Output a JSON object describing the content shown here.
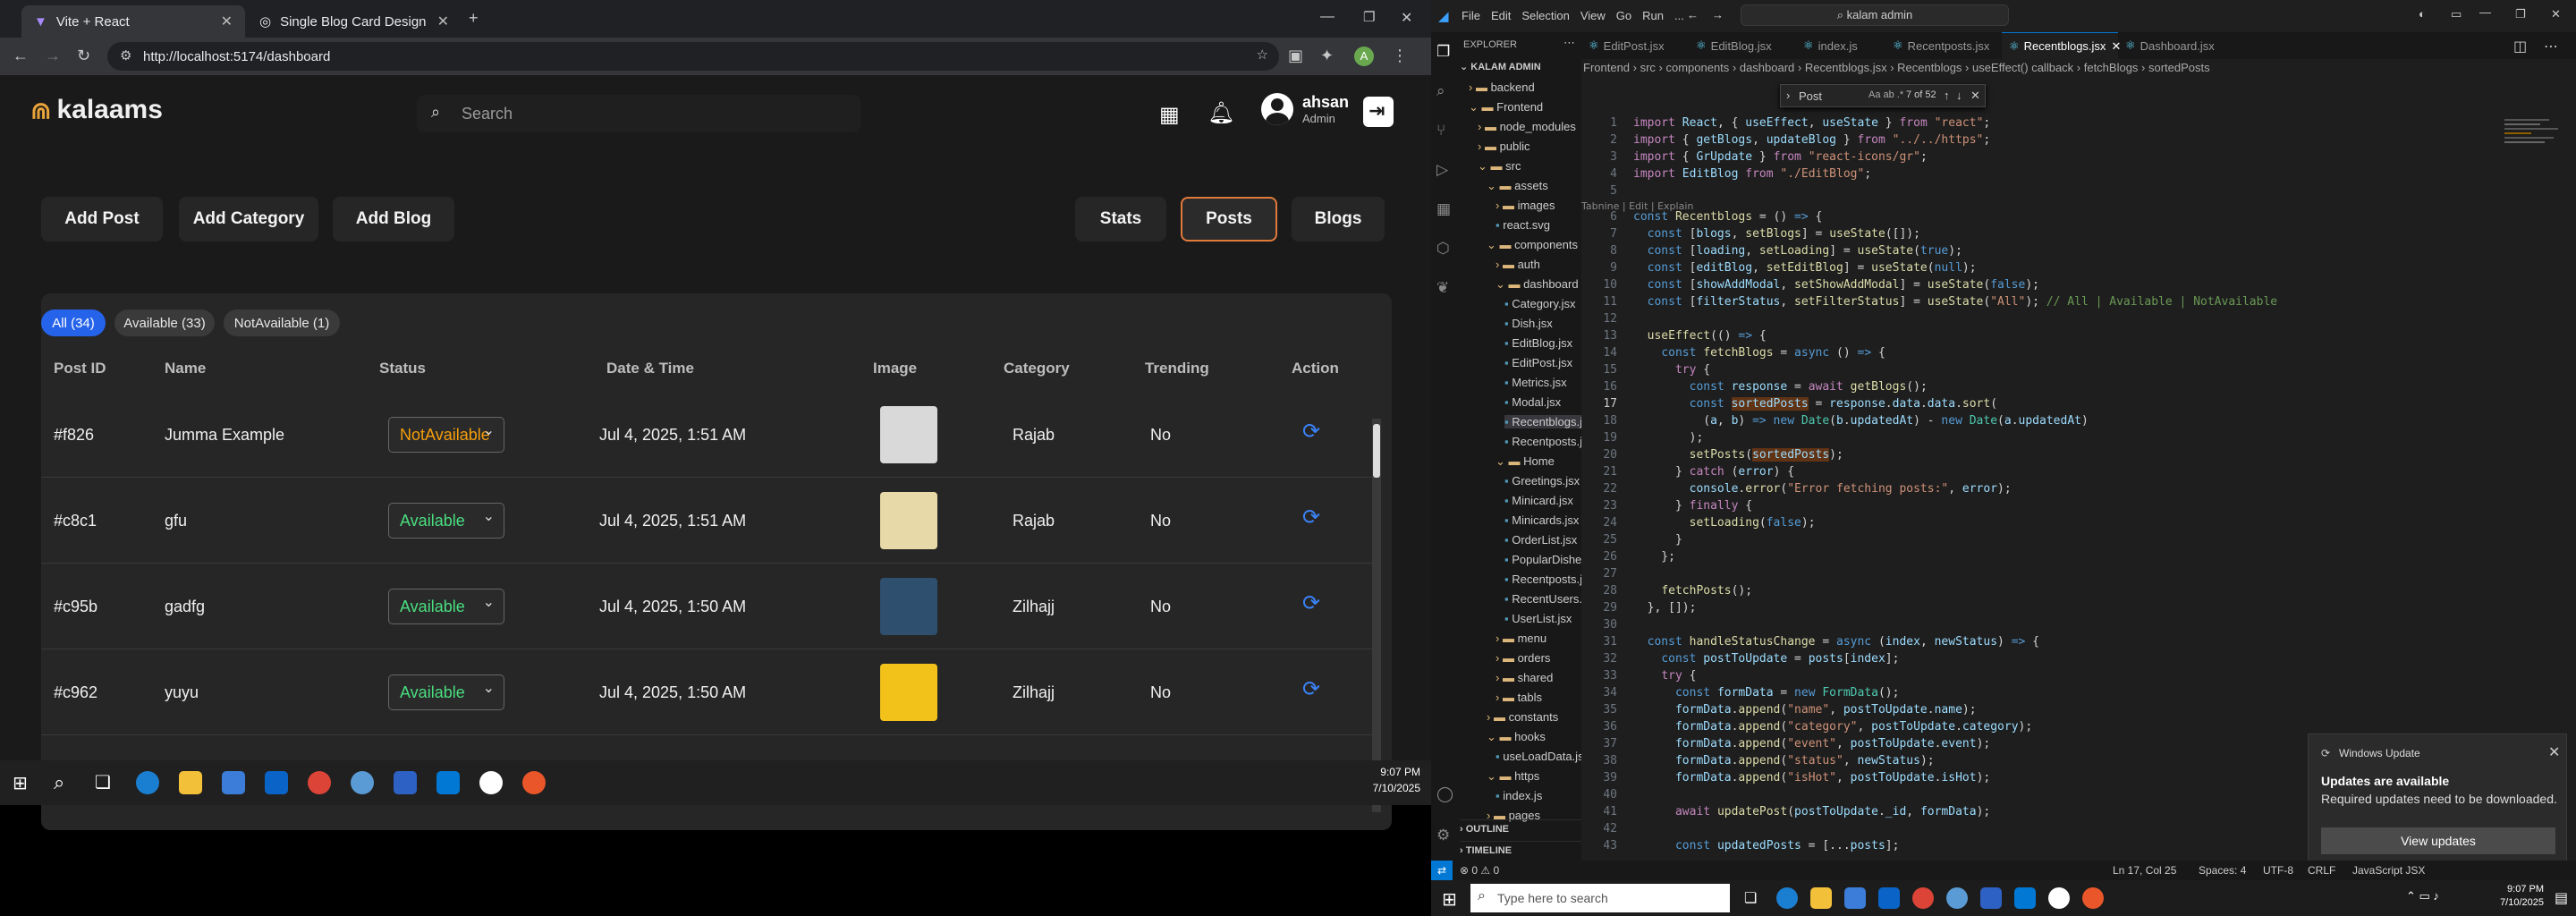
{
  "browser": {
    "tabs": [
      {
        "title": "Vite + React"
      },
      {
        "title": "Single Blog Card Design"
      }
    ],
    "url": "http://localhost:5174/dashboard"
  },
  "app": {
    "logo": "kalaams",
    "search_placeholder": "Search",
    "user": {
      "name": "ahsan",
      "role": "Admin"
    },
    "actions": [
      "Add Post",
      "Add Category",
      "Add Blog"
    ],
    "views": [
      "Stats",
      "Posts",
      "Blogs"
    ],
    "active_view": "Posts",
    "filters": [
      "All (34)",
      "Available (33)",
      "NotAvailable (1)"
    ],
    "columns": [
      "Post ID",
      "Name",
      "Status",
      "Date & Time",
      "Image",
      "Category",
      "Trending",
      "Action"
    ],
    "rows": [
      {
        "id": "#f826",
        "name": "Jumma Example",
        "status": "NotAvailable",
        "date": "Jul 4, 2025, 1:51 AM",
        "category": "Rajab",
        "trending": "No",
        "thumb": "#d9d9d9"
      },
      {
        "id": "#c8c1",
        "name": "gfu",
        "status": "Available",
        "date": "Jul 4, 2025, 1:51 AM",
        "category": "Rajab",
        "trending": "No",
        "thumb": "#e8d9a8"
      },
      {
        "id": "#c95b",
        "name": "gadfg",
        "status": "Available",
        "date": "Jul 4, 2025, 1:50 AM",
        "category": "Zilhajj",
        "trending": "No",
        "thumb": "#2f4f6f"
      },
      {
        "id": "#c962",
        "name": "yuyu",
        "status": "Available",
        "date": "Jul 4, 2025, 1:50 AM",
        "category": "Zilhajj",
        "trending": "No",
        "thumb": "#f2c21b"
      }
    ]
  },
  "taskbar_left": {
    "time": "9:07 PM",
    "date": "7/10/2025"
  },
  "vscode": {
    "menu": [
      "File",
      "Edit",
      "Selection",
      "View",
      "Go",
      "Run",
      "..."
    ],
    "command_center": "kalam admin",
    "tabs": [
      "EditPost.jsx",
      "EditBlog.jsx",
      "index.js",
      "Recentposts.jsx",
      "Recentblogs.jsx",
      "Dashboard.jsx"
    ],
    "active_tab": "Recentblogs.jsx",
    "breadcrumbs": "Frontend › src › components › dashboard › Recentblogs.jsx › Recentblogs › useEffect() callback › fetchBlogs › sortedPosts",
    "find": {
      "query": "Post",
      "result": "7 of 52"
    },
    "explorer_title": "EXPLORER",
    "project": "KALAM ADMIN",
    "tree": [
      {
        "d": 1,
        "t": "backend",
        "f": "folder",
        "o": false
      },
      {
        "d": 1,
        "t": "Frontend",
        "f": "folder",
        "o": true
      },
      {
        "d": 2,
        "t": "node_modules",
        "f": "folder",
        "o": false
      },
      {
        "d": 2,
        "t": "public",
        "f": "folder",
        "o": false
      },
      {
        "d": 2,
        "t": "src",
        "f": "folder",
        "o": true
      },
      {
        "d": 3,
        "t": "assets",
        "f": "folder",
        "o": true
      },
      {
        "d": 4,
        "t": "images",
        "f": "folder",
        "o": false
      },
      {
        "d": 4,
        "t": "react.svg",
        "f": "file"
      },
      {
        "d": 3,
        "t": "components",
        "f": "folder",
        "o": true
      },
      {
        "d": 4,
        "t": "auth",
        "f": "folder",
        "o": false
      },
      {
        "d": 4,
        "t": "dashboard",
        "f": "folder",
        "o": true
      },
      {
        "d": 5,
        "t": "Category.jsx",
        "f": "file"
      },
      {
        "d": 5,
        "t": "Dish.jsx",
        "f": "file"
      },
      {
        "d": 5,
        "t": "EditBlog.jsx",
        "f": "file"
      },
      {
        "d": 5,
        "t": "EditPost.jsx",
        "f": "file"
      },
      {
        "d": 5,
        "t": "Metrics.jsx",
        "f": "file"
      },
      {
        "d": 5,
        "t": "Modal.jsx",
        "f": "file"
      },
      {
        "d": 5,
        "t": "Recentblogs.jsx",
        "f": "file",
        "sel": true
      },
      {
        "d": 5,
        "t": "Recentposts.jsx",
        "f": "file"
      },
      {
        "d": 4,
        "t": "Home",
        "f": "folder",
        "o": true
      },
      {
        "d": 5,
        "t": "Greetings.jsx",
        "f": "file"
      },
      {
        "d": 5,
        "t": "Minicard.jsx",
        "f": "file"
      },
      {
        "d": 5,
        "t": "Minicards.jsx",
        "f": "file"
      },
      {
        "d": 5,
        "t": "OrderList.jsx",
        "f": "file"
      },
      {
        "d": 5,
        "t": "PopularDishes.jsx",
        "f": "file"
      },
      {
        "d": 5,
        "t": "Recentposts.jsx",
        "f": "file"
      },
      {
        "d": 5,
        "t": "RecentUsers.jsx",
        "f": "file"
      },
      {
        "d": 5,
        "t": "UserList.jsx",
        "f": "file"
      },
      {
        "d": 4,
        "t": "menu",
        "f": "folder",
        "o": false
      },
      {
        "d": 4,
        "t": "orders",
        "f": "folder",
        "o": false
      },
      {
        "d": 4,
        "t": "shared",
        "f": "folder",
        "o": false
      },
      {
        "d": 4,
        "t": "tabls",
        "f": "folder",
        "o": false
      },
      {
        "d": 3,
        "t": "constants",
        "f": "folder",
        "o": false
      },
      {
        "d": 3,
        "t": "hooks",
        "f": "folder",
        "o": true
      },
      {
        "d": 4,
        "t": "useLoadData.js",
        "f": "file"
      },
      {
        "d": 3,
        "t": "https",
        "f": "folder",
        "o": true
      },
      {
        "d": 4,
        "t": "index.js",
        "f": "file"
      },
      {
        "d": 3,
        "t": "pages",
        "f": "folder",
        "o": false
      }
    ],
    "outline": "OUTLINE",
    "timeline": "TIMELINE",
    "code_lens": "Tabnine | Edit | Explain",
    "code": [
      {
        "n": 1,
        "h": "<span class='kc'>import</span> <span class='vr'>React</span>, { <span class='vr'>useEffect</span>, <span class='vr'>useState</span> } <span class='kc'>from</span> <span class='str'>\"react\"</span>;"
      },
      {
        "n": 2,
        "h": "<span class='kc'>import</span> { <span class='vr'>getBlogs</span>, <span class='vr'>updateBlog</span> } <span class='kc'>from</span> <span class='str'>\"../../https\"</span>;"
      },
      {
        "n": 3,
        "h": "<span class='kc'>import</span> { <span class='vr'>GrUpdate</span> } <span class='kc'>from</span> <span class='str'>\"react-icons/gr\"</span>;"
      },
      {
        "n": 4,
        "h": "<span class='kc'>import</span> <span class='vr'>EditBlog</span> <span class='kc'>from</span> <span class='str'>\"./EditBlog\"</span>;"
      },
      {
        "n": 5,
        "h": ""
      },
      {
        "n": 6,
        "h": "<span class='kw'>const</span> <span class='fn'>Recentblogs</span> = () <span class='kw'>=&gt;</span> {"
      },
      {
        "n": 7,
        "h": "  <span class='kw'>const</span> [<span class='vr'>blogs</span>, <span class='fn'>setBlogs</span>] = <span class='fn'>useState</span>([]);"
      },
      {
        "n": 8,
        "h": "  <span class='kw'>const</span> [<span class='vr'>loading</span>, <span class='fn'>setLoading</span>] = <span class='fn'>useState</span>(<span class='kw'>true</span>);"
      },
      {
        "n": 9,
        "h": "  <span class='kw'>const</span> [<span class='vr'>editBlog</span>, <span class='fn'>setEditBlog</span>] = <span class='fn'>useState</span>(<span class='kw'>null</span>);"
      },
      {
        "n": 10,
        "h": "  <span class='kw'>const</span> [<span class='vr'>showAddModal</span>, <span class='fn'>setShowAddModal</span>] = <span class='fn'>useState</span>(<span class='kw'>false</span>);"
      },
      {
        "n": 11,
        "h": "  <span class='kw'>const</span> [<span class='vr'>filterStatus</span>, <span class='fn'>setFilterStatus</span>] = <span class='fn'>useState</span>(<span class='str'>\"All\"</span>); <span class='cm'>// All | Available | NotAvailable</span>"
      },
      {
        "n": 12,
        "h": ""
      },
      {
        "n": 13,
        "h": "  <span class='fn'>useEffect</span>(() <span class='kw'>=&gt;</span> {"
      },
      {
        "n": 14,
        "h": "    <span class='kw'>const</span> <span class='fn'>fetchBlogs</span> = <span class='kw'>async</span> () <span class='kw'>=&gt;</span> {"
      },
      {
        "n": 15,
        "h": "      <span class='kc'>try</span> {"
      },
      {
        "n": 16,
        "h": "        <span class='kw'>const</span> <span class='vr'>response</span> = <span class='kc'>await</span> <span class='fn'>getBlogs</span>();"
      },
      {
        "n": 17,
        "h": "        <span class='kw'>const</span> <span class='vr hl'>sortedPosts</span> = <span class='vr'>response</span>.<span class='vr'>data</span>.<span class='vr'>data</span>.<span class='fn'>sort</span>("
      },
      {
        "n": 18,
        "h": "          (<span class='vr'>a</span>, <span class='vr'>b</span>) <span class='kw'>=&gt;</span> <span class='kw'>new</span> <span class='ty'>Date</span>(<span class='vr'>b</span>.<span class='vr'>updatedAt</span>) - <span class='kw'>new</span> <span class='ty'>Date</span>(<span class='vr'>a</span>.<span class='vr'>updatedAt</span>)"
      },
      {
        "n": 19,
        "h": "        );"
      },
      {
        "n": 20,
        "h": "        <span class='fn'>setPosts</span>(<span class='vr hl'>sortedPosts</span>);"
      },
      {
        "n": 21,
        "h": "      } <span class='kc'>catch</span> (<span class='vr'>error</span>) {"
      },
      {
        "n": 22,
        "h": "        <span class='vr'>console</span>.<span class='fn'>error</span>(<span class='str'>\"Error fetching posts:\"</span>, <span class='vr'>error</span>);"
      },
      {
        "n": 23,
        "h": "      } <span class='kc'>finally</span> {"
      },
      {
        "n": 24,
        "h": "        <span class='fn'>setLoading</span>(<span class='kw'>false</span>);"
      },
      {
        "n": 25,
        "h": "      }"
      },
      {
        "n": 26,
        "h": "    };"
      },
      {
        "n": 27,
        "h": ""
      },
      {
        "n": 28,
        "h": "    <span class='fn'>fetchPosts</span>();"
      },
      {
        "n": 29,
        "h": "  }, []);"
      },
      {
        "n": 30,
        "h": ""
      },
      {
        "n": 31,
        "h": "  <span class='kw'>const</span> <span class='fn'>handleStatusChange</span> = <span class='kw'>async</span> (<span class='vr'>index</span>, <span class='vr'>newStatus</span>) <span class='kw'>=&gt;</span> {"
      },
      {
        "n": 32,
        "h": "    <span class='kw'>const</span> <span class='vr'>postToUpdate</span> = <span class='vr'>posts</span>[<span class='vr'>index</span>];"
      },
      {
        "n": 33,
        "h": "    <span class='kc'>try</span> {"
      },
      {
        "n": 34,
        "h": "      <span class='kw'>const</span> <span class='vr'>formData</span> = <span class='kw'>new</span> <span class='ty'>FormData</span>();"
      },
      {
        "n": 35,
        "h": "      <span class='vr'>formData</span>.<span class='fn'>append</span>(<span class='str'>\"name\"</span>, <span class='vr'>postToUpdate</span>.<span class='vr'>name</span>);"
      },
      {
        "n": 36,
        "h": "      <span class='vr'>formData</span>.<span class='fn'>append</span>(<span class='str'>\"category\"</span>, <span class='vr'>postToUpdate</span>.<span class='vr'>category</span>);"
      },
      {
        "n": 37,
        "h": "      <span class='vr'>formData</span>.<span class='fn'>append</span>(<span class='str'>\"event\"</span>, <span class='vr'>postToUpdate</span>.<span class='vr'>event</span>);"
      },
      {
        "n": 38,
        "h": "      <span class='vr'>formData</span>.<span class='fn'>append</span>(<span class='str'>\"status\"</span>, <span class='vr'>newStatus</span>);"
      },
      {
        "n": 39,
        "h": "      <span class='vr'>formData</span>.<span class='fn'>append</span>(<span class='str'>\"isHot\"</span>, <span class='vr'>postToUpdate</span>.<span class='vr'>isHot</span>);"
      },
      {
        "n": 40,
        "h": ""
      },
      {
        "n": 41,
        "h": "      <span class='kc'>await</span> <span class='fn'>updatePost</span>(<span class='vr'>postToUpdate</span>.<span class='vr'>_id</span>, <span class='vr'>formData</span>);"
      },
      {
        "n": 42,
        "h": ""
      },
      {
        "n": 43,
        "h": "      <span class='kw'>const</span> <span class='vr'>updatedPosts</span> = [...<span class='vr'>posts</span>];"
      }
    ],
    "status_bar": {
      "cursor": "Ln 17, Col 25",
      "spaces": "Spaces: 4",
      "encoding": "UTF-8",
      "eol": "CRLF",
      "lang": "JavaScript JSX",
      "problems": "⊗ 0 ⚠ 0"
    },
    "toast": {
      "source": "Windows Update",
      "title": "Updates are available",
      "body": "Required updates need to be downloaded.",
      "button": "View updates"
    },
    "taskbar": {
      "search_placeholder": "Type here to search",
      "time": "9:07 PM",
      "date": "7/10/2025"
    }
  }
}
